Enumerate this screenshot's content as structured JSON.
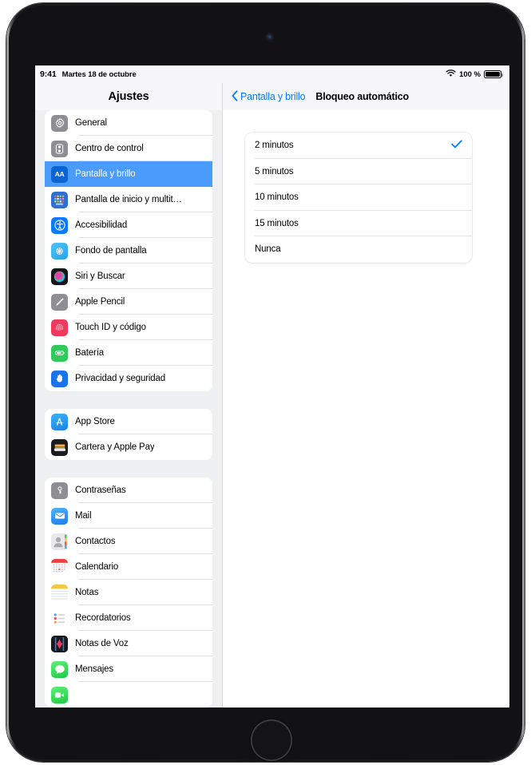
{
  "status_bar": {
    "time": "9:41",
    "date": "Martes 18 de octubre",
    "wifi_icon": "wifi-icon",
    "battery_percent": "100 %",
    "battery_icon": "battery-full-icon"
  },
  "sidebar": {
    "title": "Ajustes",
    "groups": [
      {
        "items": [
          {
            "label": "General",
            "icon": "gear-icon",
            "selected": false
          },
          {
            "label": "Centro de control",
            "icon": "control-center-icon",
            "selected": false
          },
          {
            "label": "Pantalla y brillo",
            "icon": "display-brightness-icon",
            "selected": true
          },
          {
            "label": "Pantalla de inicio y multit…",
            "icon": "home-screen-multitasking-icon",
            "selected": false
          },
          {
            "label": "Accesibilidad",
            "icon": "accessibility-icon",
            "selected": false
          },
          {
            "label": "Fondo de pantalla",
            "icon": "wallpaper-icon",
            "selected": false
          },
          {
            "label": "Siri y Buscar",
            "icon": "siri-icon",
            "selected": false
          },
          {
            "label": "Apple Pencil",
            "icon": "apple-pencil-icon",
            "selected": false
          },
          {
            "label": "Touch ID y código",
            "icon": "touch-id-icon",
            "selected": false
          },
          {
            "label": "Batería",
            "icon": "battery-icon",
            "selected": false
          },
          {
            "label": "Privacidad y seguridad",
            "icon": "privacy-hand-icon",
            "selected": false
          }
        ]
      },
      {
        "items": [
          {
            "label": "App Store",
            "icon": "app-store-icon",
            "selected": false
          },
          {
            "label": "Cartera y Apple Pay",
            "icon": "wallet-icon",
            "selected": false
          }
        ]
      },
      {
        "items": [
          {
            "label": "Contraseñas",
            "icon": "passwords-key-icon",
            "selected": false
          },
          {
            "label": "Mail",
            "icon": "mail-icon",
            "selected": false
          },
          {
            "label": "Contactos",
            "icon": "contacts-icon",
            "selected": false
          },
          {
            "label": "Calendario",
            "icon": "calendar-icon",
            "selected": false
          },
          {
            "label": "Notas",
            "icon": "notes-icon",
            "selected": false
          },
          {
            "label": "Recordatorios",
            "icon": "reminders-icon",
            "selected": false
          },
          {
            "label": "Notas de Voz",
            "icon": "voice-memos-icon",
            "selected": false
          },
          {
            "label": "Mensajes",
            "icon": "messages-icon",
            "selected": false
          },
          {
            "label": "",
            "icon": "facetime-icon",
            "selected": false
          }
        ]
      }
    ]
  },
  "detail": {
    "back_label": "Pantalla y brillo",
    "back_icon": "chevron-left-icon",
    "title": "Bloqueo automático",
    "options": [
      {
        "label": "2 minutos",
        "checked": true
      },
      {
        "label": "5 minutos",
        "checked": false
      },
      {
        "label": "10 minutos",
        "checked": false
      },
      {
        "label": "15 minutos",
        "checked": false
      },
      {
        "label": "Nunca",
        "checked": false
      }
    ],
    "check_icon": "checkmark-icon"
  },
  "colors": {
    "accent": "#007aff",
    "selection": "#4b9cfa",
    "sidebar_bg": "#eff0f4",
    "card_bg": "#ffffff"
  }
}
